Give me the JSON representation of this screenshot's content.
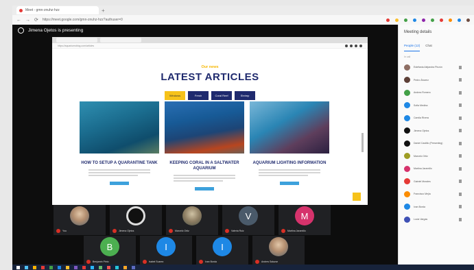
{
  "browser": {
    "tab_title": "Meet - gmn-znuhz-hzz",
    "url": "https://meet.google.com/gmn-znuhz-hzz?authuser=0",
    "extension_colors": [
      "#e53935",
      "#fbc02d",
      "#43a047",
      "#1e88e5",
      "#8e24aa",
      "#43a047",
      "#e53935",
      "#fb8c00",
      "#1e88e5",
      "#6d4c41"
    ]
  },
  "presenter": {
    "banner": "Jimena Ojetos is presenting"
  },
  "shared_site": {
    "url": "https://aquariumsblog.com/articles",
    "kicker": "Our news",
    "headline": "LATEST ARTICLES",
    "filters": [
      {
        "label": "Windows",
        "active": true
      },
      {
        "label": "Fresh",
        "active": false
      },
      {
        "label": "Coral Reef",
        "active": false
      },
      {
        "label": "Shrimp",
        "active": false
      }
    ],
    "articles": [
      {
        "title": "HOW TO SETUP A QUARANTINE TANK"
      },
      {
        "title": "KEEPING CORAL IN A SALTWATER AQUARIUM"
      },
      {
        "title": "AQUARIUM LIGHTING INFORMATION"
      }
    ]
  },
  "participants": [
    {
      "name": "You",
      "avatar": "",
      "avatar_type": "photo"
    },
    {
      "name": "Jimena Ojetos",
      "avatar": "",
      "avatar_type": "dark"
    },
    {
      "name": "Marcelo Ortiz",
      "avatar": "",
      "avatar_type": "grey"
    },
    {
      "name": "Valeria Ruiz",
      "avatar": "V",
      "avatar_type": "letter",
      "color": "#4a5a6a"
    },
    {
      "name": "Martina Jaramillo",
      "avatar": "M",
      "avatar_type": "letter",
      "color": "#d6336c"
    },
    {
      "name": "Benjamin Pinto",
      "avatar": "B",
      "avatar_type": "letter",
      "color": "#4caf50"
    },
    {
      "name": "Isabel Suarez",
      "avatar": "I",
      "avatar_type": "letter",
      "color": "#1e88e5"
    },
    {
      "name": "Ivan Borda",
      "avatar": "I",
      "avatar_type": "letter",
      "color": "#1e88e5"
    },
    {
      "name": "Andres Salazar",
      "avatar": "",
      "avatar_type": "photo"
    }
  ],
  "panel": {
    "title": "Meeting details",
    "tabs": [
      "People (12)",
      "Chat"
    ],
    "section_label": "In call",
    "people": [
      {
        "name": "Estefania Alejandra Pinzón",
        "color": "#8d6e63"
      },
      {
        "name": "Pedro Álvarez",
        "color": "#5d4037"
      },
      {
        "name": "Andrea Romero",
        "color": "#43a047"
      },
      {
        "name": "Sofia Medina",
        "color": "#1e88e5"
      },
      {
        "name": "Camila Rivera",
        "color": "#1e88e5"
      },
      {
        "name": "Jimena Ojetos",
        "color": "#111111"
      },
      {
        "name": "Daniel Castillo (Presenting)",
        "color": "#111111"
      },
      {
        "name": "Marcelo Ortiz",
        "color": "#9e9d24"
      },
      {
        "name": "Martina Jaramillo",
        "color": "#d6336c"
      },
      {
        "name": "Gabriel Morales",
        "color": "#e53935"
      },
      {
        "name": "Francisco Mejía",
        "color": "#fb8c00"
      },
      {
        "name": "Ivan Borda",
        "color": "#1e88e5"
      },
      {
        "name": "Lucia Vargas",
        "color": "#3f51b5"
      }
    ]
  },
  "taskbar": {
    "icon_colors": [
      "#ffffff",
      "#4fc3f7",
      "#ffb300",
      "#e53935",
      "#43a047",
      "#1e88e5",
      "#fbc02d",
      "#7e57c2",
      "#e53935",
      "#29b6f6",
      "#66bb6a",
      "#ef5350",
      "#26c6da",
      "#ffa726",
      "#5c6bc0"
    ]
  }
}
